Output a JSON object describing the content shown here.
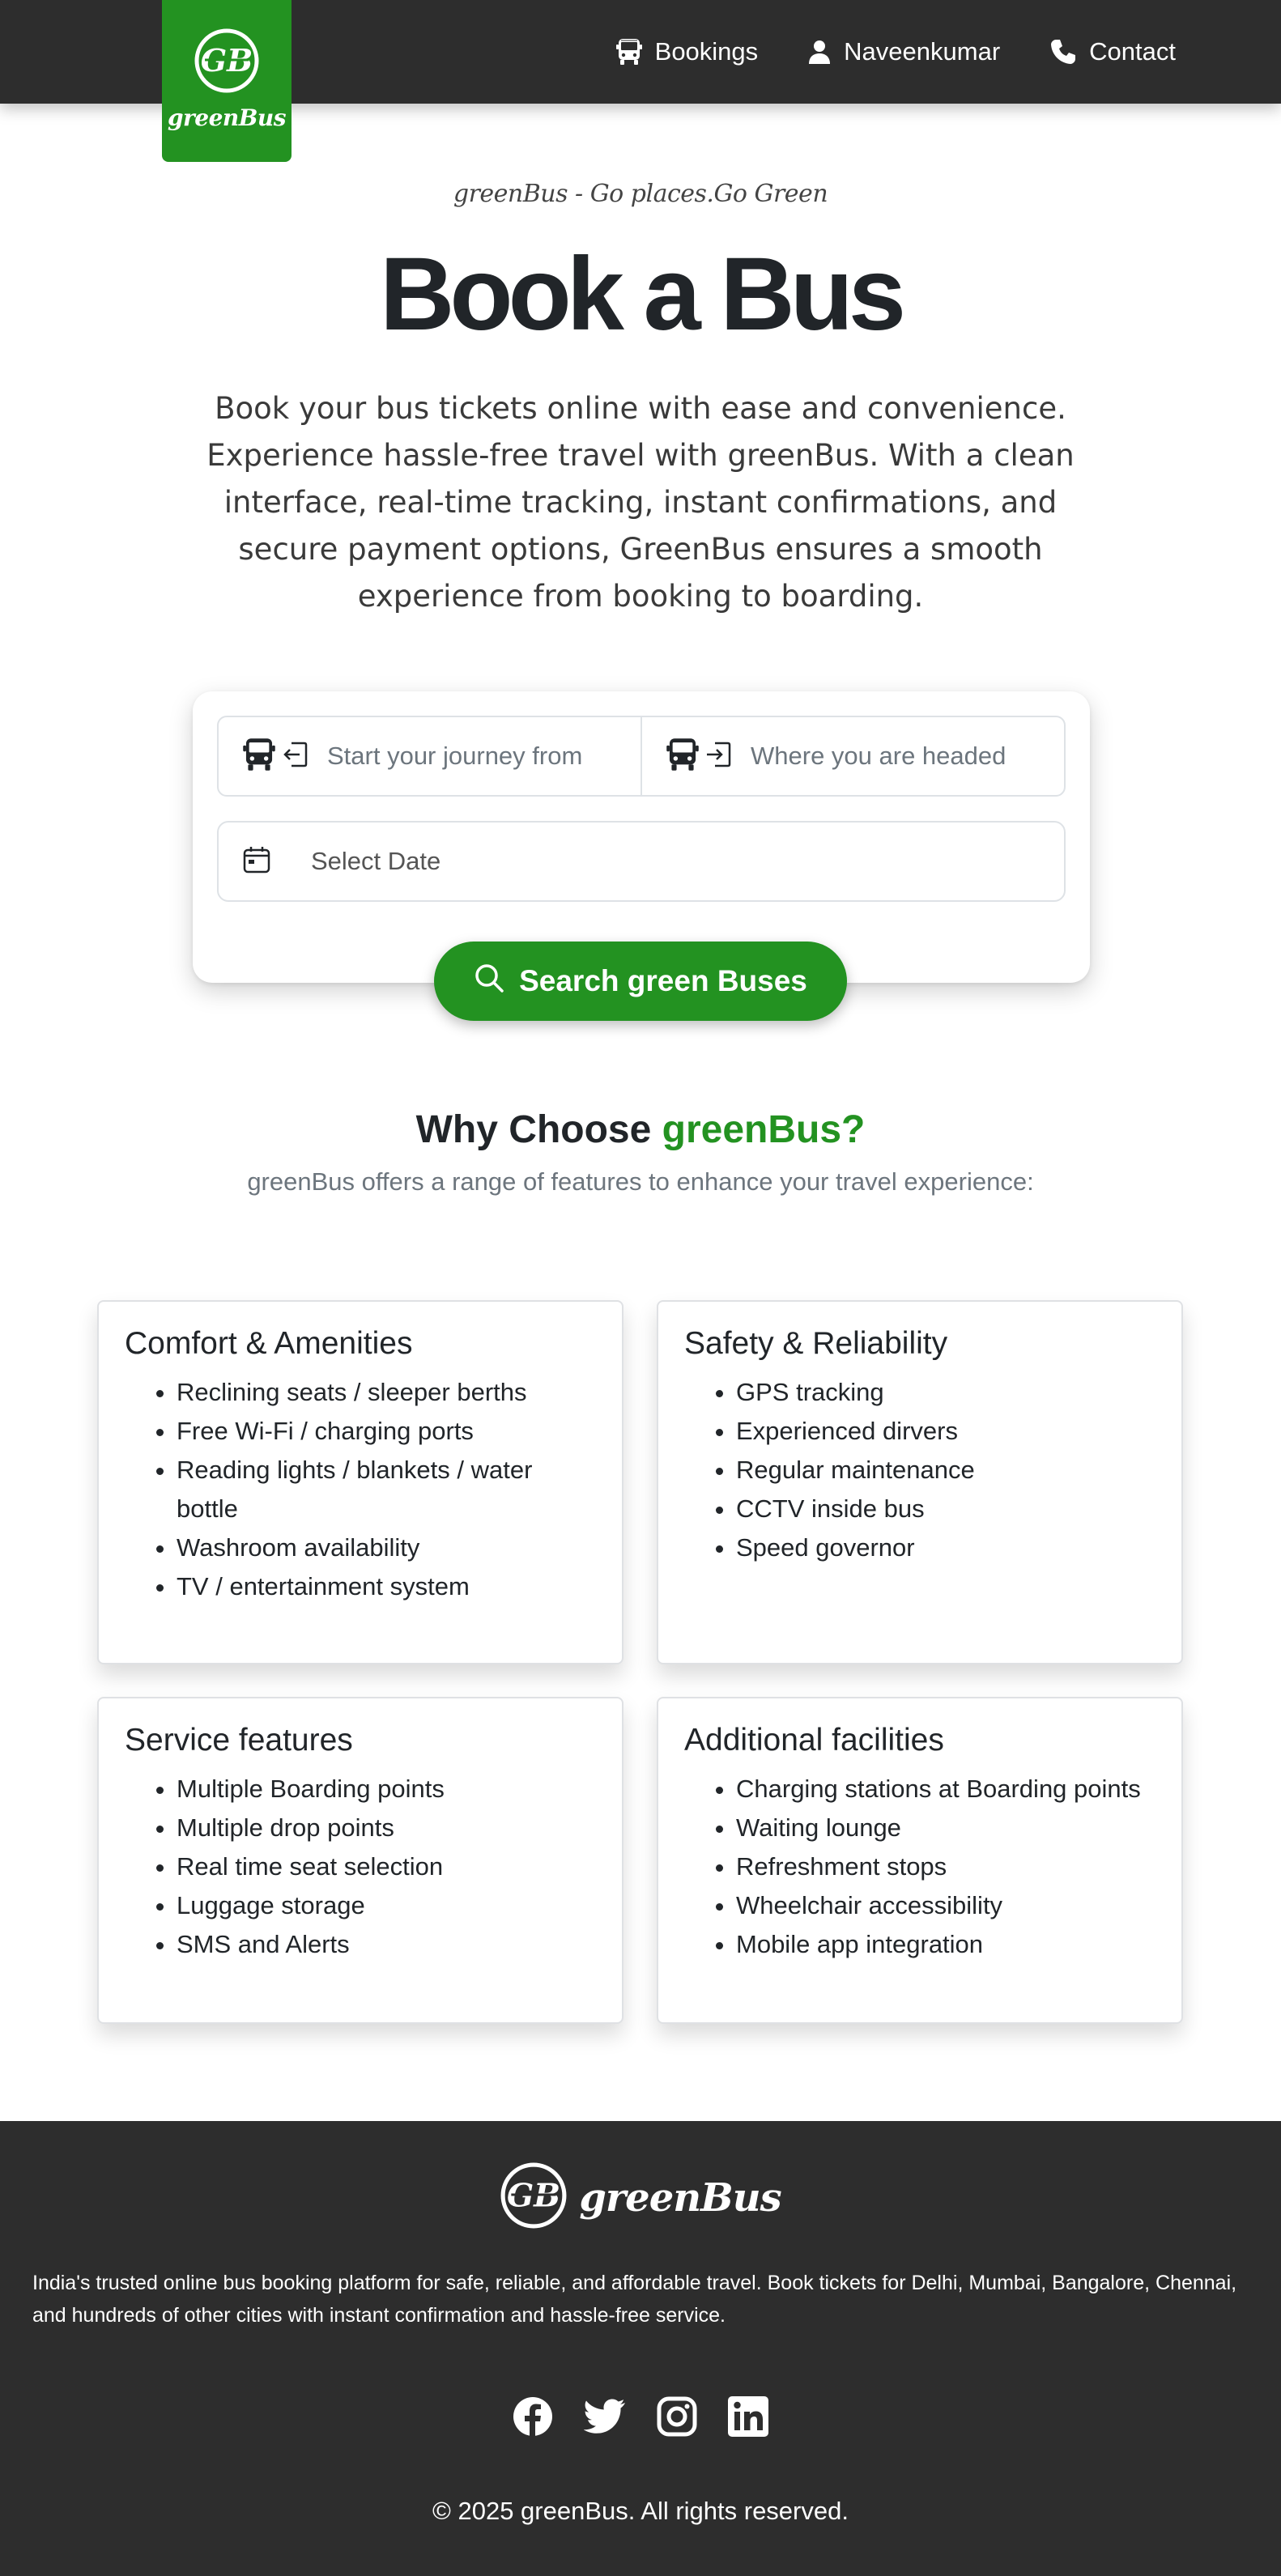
{
  "brand": {
    "name": "greenBus",
    "primary_color": "#239221",
    "dark_color": "#2d2d2d"
  },
  "nav": {
    "items": [
      {
        "label": "Bookings",
        "icon": "bus-icon"
      },
      {
        "label": "Naveenkumar",
        "icon": "user-icon"
      },
      {
        "label": "Contact",
        "icon": "phone-icon"
      }
    ]
  },
  "hero": {
    "tagline": "greenBus - Go places.Go Green",
    "title": "Book a Bus",
    "description": "Book your bus tickets online with ease and convenience. Experience hassle-free travel with greenBus. With a clean interface, real-time tracking, instant confirmations, and secure payment options, GreenBus ensures a smooth experience from booking to boarding."
  },
  "search": {
    "from_placeholder": "Start your journey from",
    "to_placeholder": "Where you are headed",
    "date_placeholder": "Select Date",
    "button_label": "Search green Buses"
  },
  "why": {
    "title_prefix": "Why Choose ",
    "title_accent": "greenBus?",
    "subtitle": "greenBus offers a range of features to enhance your travel experience:"
  },
  "features": [
    {
      "title": "Comfort & Amenities",
      "items": [
        "Reclining seats / sleeper berths",
        "Free Wi-Fi / charging ports",
        "Reading lights / blankets / water bottle",
        "Washroom availability",
        "TV / entertainment system"
      ]
    },
    {
      "title": "Safety & Reliability",
      "items": [
        "GPS tracking",
        "Experienced dirvers",
        "Regular maintenance",
        "CCTV inside bus",
        "Speed governor"
      ]
    },
    {
      "title": "Service features",
      "items": [
        "Multiple Boarding points",
        "Multiple drop points",
        "Real time seat selection",
        "Luggage storage",
        "SMS and Alerts"
      ]
    },
    {
      "title": "Additional facilities",
      "items": [
        "Charging stations at Boarding points",
        "Waiting lounge",
        "Refreshment stops",
        "Wheelchair accessibility",
        "Mobile app integration"
      ]
    }
  ],
  "footer": {
    "brand": "greenBus",
    "description": "India's trusted online bus booking platform for safe, reliable, and affordable travel. Book tickets for Delhi, Mumbai, Bangalore, Chennai, and hundreds of other cities with instant confirmation and hassle-free service.",
    "socials": [
      "facebook-icon",
      "twitter-icon",
      "instagram-icon",
      "linkedin-icon"
    ],
    "copyright": "© 2025 greenBus. All rights reserved."
  }
}
